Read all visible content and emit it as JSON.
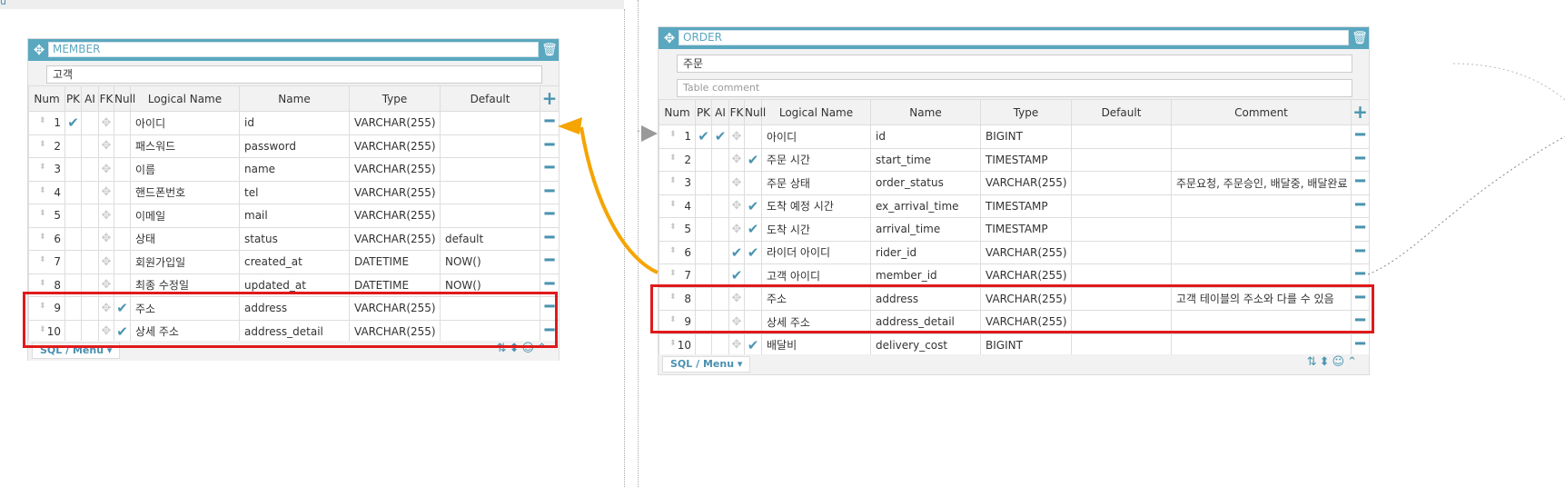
{
  "top_fragment": {
    "menu_label": "u",
    "icons": [
      "sort-icon",
      "updown-icon",
      "comment-icon",
      "collapse-icon"
    ]
  },
  "member": {
    "title": "MEMBER",
    "comment": "고객",
    "headers": [
      "Num",
      "PK",
      "AI",
      "FK",
      "Null",
      "Logical Name",
      "Name",
      "Type",
      "Default"
    ],
    "rows": [
      {
        "num": "1",
        "pk": true,
        "fk": false,
        "null": false,
        "logical": "아이디",
        "name": "id",
        "type": "VARCHAR(255)",
        "default": ""
      },
      {
        "num": "2",
        "pk": false,
        "fk": false,
        "null": false,
        "logical": "패스워드",
        "name": "password",
        "type": "VARCHAR(255)",
        "default": ""
      },
      {
        "num": "3",
        "pk": false,
        "fk": false,
        "null": false,
        "logical": "이름",
        "name": "name",
        "type": "VARCHAR(255)",
        "default": ""
      },
      {
        "num": "4",
        "pk": false,
        "fk": false,
        "null": false,
        "logical": "핸드폰번호",
        "name": "tel",
        "type": "VARCHAR(255)",
        "default": ""
      },
      {
        "num": "5",
        "pk": false,
        "fk": false,
        "null": false,
        "logical": "이메일",
        "name": "mail",
        "type": "VARCHAR(255)",
        "default": ""
      },
      {
        "num": "6",
        "pk": false,
        "fk": false,
        "null": false,
        "logical": "상태",
        "name": "status",
        "type": "VARCHAR(255)",
        "default": "default"
      },
      {
        "num": "7",
        "pk": false,
        "fk": false,
        "null": false,
        "logical": "회원가입일",
        "name": "created_at",
        "type": "DATETIME",
        "default": "NOW()"
      },
      {
        "num": "8",
        "pk": false,
        "fk": false,
        "null": false,
        "logical": "최종 수정일",
        "name": "updated_at",
        "type": "DATETIME",
        "default": "NOW()"
      },
      {
        "num": "9",
        "pk": false,
        "fk": false,
        "null": true,
        "logical": "주소",
        "name": "address",
        "type": "VARCHAR(255)",
        "default": ""
      },
      {
        "num": "10",
        "pk": false,
        "fk": false,
        "null": true,
        "logical": "상세 주소",
        "name": "address_detail",
        "type": "VARCHAR(255)",
        "default": ""
      }
    ],
    "footer_menu": "SQL / Menu"
  },
  "order": {
    "title": "ORDER",
    "comment": "주문",
    "table_comment_placeholder": "Table comment",
    "headers": [
      "Num",
      "PK",
      "AI",
      "FK",
      "Null",
      "Logical Name",
      "Name",
      "Type",
      "Default",
      "Comment"
    ],
    "rows": [
      {
        "num": "1",
        "pk": true,
        "ai": true,
        "fk": false,
        "null": false,
        "logical": "아이디",
        "name": "id",
        "type": "BIGINT",
        "default": "",
        "comment": ""
      },
      {
        "num": "2",
        "pk": false,
        "ai": false,
        "fk": false,
        "null": true,
        "logical": "주문 시간",
        "name": "start_time",
        "type": "TIMESTAMP",
        "default": "",
        "comment": ""
      },
      {
        "num": "3",
        "pk": false,
        "ai": false,
        "fk": false,
        "null": false,
        "logical": "주문 상태",
        "name": "order_status",
        "type": "VARCHAR(255)",
        "default": "",
        "comment": "주문요청, 주문승인, 배달중, 배달완료"
      },
      {
        "num": "4",
        "pk": false,
        "ai": false,
        "fk": false,
        "null": true,
        "logical": "도착 예정 시간",
        "name": "ex_arrival_time",
        "type": "TIMESTAMP",
        "default": "",
        "comment": ""
      },
      {
        "num": "5",
        "pk": false,
        "ai": false,
        "fk": false,
        "null": true,
        "logical": "도착 시간",
        "name": "arrival_time",
        "type": "TIMESTAMP",
        "default": "",
        "comment": ""
      },
      {
        "num": "6",
        "pk": false,
        "ai": false,
        "fk": true,
        "null": true,
        "logical": "라이더 아이디",
        "name": "rider_id",
        "type": "VARCHAR(255)",
        "default": "",
        "comment": ""
      },
      {
        "num": "7",
        "pk": false,
        "ai": false,
        "fk": true,
        "null": false,
        "logical": "고객 아이디",
        "name": "member_id",
        "type": "VARCHAR(255)",
        "default": "",
        "comment": ""
      },
      {
        "num": "8",
        "pk": false,
        "ai": false,
        "fk": false,
        "null": false,
        "logical": "주소",
        "name": "address",
        "type": "VARCHAR(255)",
        "default": "",
        "comment": "고객 테이블의 주소와 다를 수 있음"
      },
      {
        "num": "9",
        "pk": false,
        "ai": false,
        "fk": false,
        "null": false,
        "logical": "상세 주소",
        "name": "address_detail",
        "type": "VARCHAR(255)",
        "default": "",
        "comment": ""
      },
      {
        "num": "10",
        "pk": false,
        "ai": false,
        "fk": false,
        "null": true,
        "logical": "배달비",
        "name": "delivery_cost",
        "type": "BIGINT",
        "default": "",
        "comment": ""
      }
    ],
    "footer_menu": "SQL / Menu"
  },
  "colors": {
    "header": "#5aa7c0",
    "accent": "#4a94b0",
    "highlight": "#e0191b",
    "relation": "#f5a400"
  }
}
